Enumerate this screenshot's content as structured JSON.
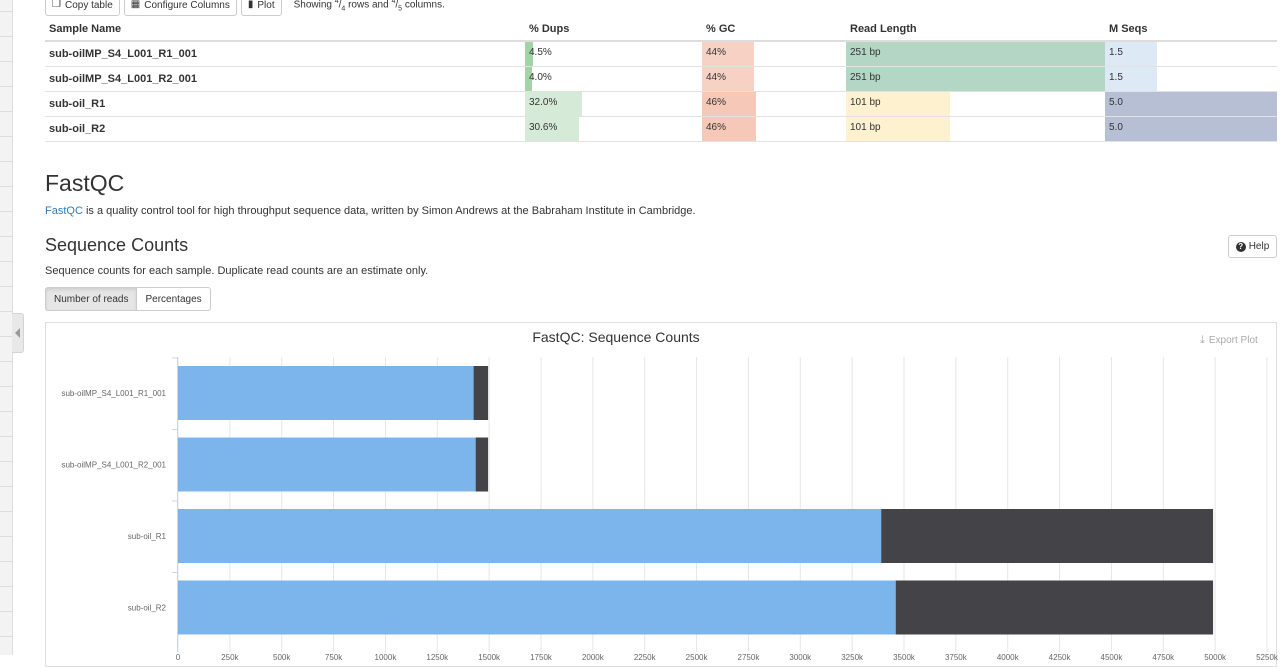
{
  "toolbar": {
    "copy_label": "Copy table",
    "configure_label": "Configure Columns",
    "plot_label": "Plot",
    "showing_prefix": "Showing ",
    "rows_shown": "4",
    "rows_total": "4",
    "rows_word": " rows and ",
    "cols_shown": "4",
    "cols_total": "5",
    "cols_word": " columns."
  },
  "table": {
    "headers": [
      "Sample Name",
      "% Dups",
      "% GC",
      "Read Length",
      "M Seqs"
    ],
    "rows": [
      {
        "name": "sub-oilMP_S4_L001_R1_001",
        "dups": "4.5%",
        "dups_val": 4.5,
        "gc": "44%",
        "gc_val": 44,
        "readlen": "251 bp",
        "readlen_val": 251,
        "mseqs": "1.5",
        "mseqs_val": 1.5
      },
      {
        "name": "sub-oilMP_S4_L001_R2_001",
        "dups": "4.0%",
        "dups_val": 4.0,
        "gc": "44%",
        "gc_val": 44,
        "readlen": "251 bp",
        "readlen_val": 251,
        "mseqs": "1.5",
        "mseqs_val": 1.5
      },
      {
        "name": "sub-oil_R1",
        "dups": "32.0%",
        "dups_val": 32.0,
        "gc": "46%",
        "gc_val": 46,
        "readlen": "101 bp",
        "readlen_val": 101,
        "mseqs": "5.0",
        "mseqs_val": 5.0
      },
      {
        "name": "sub-oil_R2",
        "dups": "30.6%",
        "dups_val": 30.6,
        "gc": "46%",
        "gc_val": 46,
        "readlen": "101 bp",
        "readlen_val": 101,
        "mseqs": "5.0",
        "mseqs_val": 5.0
      }
    ]
  },
  "fastqc": {
    "title": "FastQC",
    "link_text": "FastQC",
    "description": " is a quality control tool for high throughput sequence data, written by Simon Andrews at the Babraham Institute in Cambridge."
  },
  "seq_counts": {
    "title": "Sequence Counts",
    "help_label": "Help",
    "description": "Sequence counts for each sample. Duplicate read counts are an estimate only.",
    "btn_reads": "Number of reads",
    "btn_percent": "Percentages",
    "export_label": "Export Plot"
  },
  "colors": {
    "unique": "#7cb5ec",
    "duplicate": "#434348",
    "link": "#337ab7",
    "dups_bar": "#5aae61",
    "gc_bar": "#ee9a7b",
    "readlen_bar": "#1b7837",
    "readlen_bar_short": "#fee8b0",
    "mseqs_bar": "#4a6491"
  },
  "chart_data": {
    "type": "bar",
    "orientation": "horizontal",
    "stacked": true,
    "title": "FastQC: Sequence Counts",
    "categories": [
      "sub-oilMP_S4_L001_R1_001",
      "sub-oilMP_S4_L001_R2_001",
      "sub-oil_R1",
      "sub-oil_R2"
    ],
    "series": [
      {
        "values": [
          1425000,
          1435000,
          3390000,
          3460000
        ]
      },
      {
        "values": [
          70000,
          60000,
          1600000,
          1530000
        ]
      }
    ],
    "xlim": [
      0,
      5250000
    ],
    "x_tick_labels": [
      "0",
      "250k",
      "500k",
      "750k",
      "1000k",
      "1250k",
      "1500k",
      "1750k",
      "2000k",
      "2250k",
      "2500k",
      "2750k",
      "3000k",
      "3250k",
      "3500k",
      "3750k",
      "4000k",
      "4250k",
      "4500k",
      "4750k",
      "5000k",
      "5250k"
    ],
    "grid": true,
    "legend": "none"
  }
}
